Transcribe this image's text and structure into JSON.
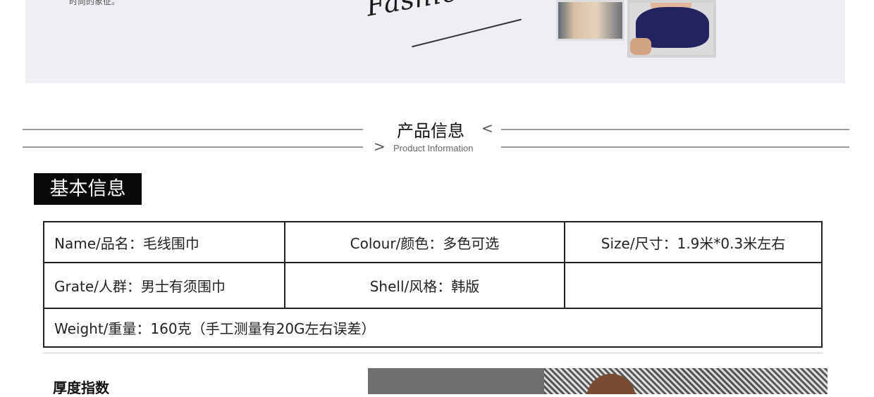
{
  "banner": {
    "text": "时尚的象征。",
    "script": "Fashion daily"
  },
  "section": {
    "title": "产品信息",
    "subtitle": "Product Information",
    "left_chevron": "<",
    "right_chevron": ">"
  },
  "basic_info_tag": "基本信息",
  "info": {
    "row1": [
      "Name/品名：毛线围巾",
      "Colour/颜色：多色可选",
      "Size/尺寸：1.9米*0.3米左右"
    ],
    "row2": [
      "Grate/人群：男士有须围巾",
      "Shell/风格：韩版",
      ""
    ],
    "row3": "Weight/重量：160克（手工测量有20G左右误差）"
  },
  "thickness_label": "厚度指数"
}
